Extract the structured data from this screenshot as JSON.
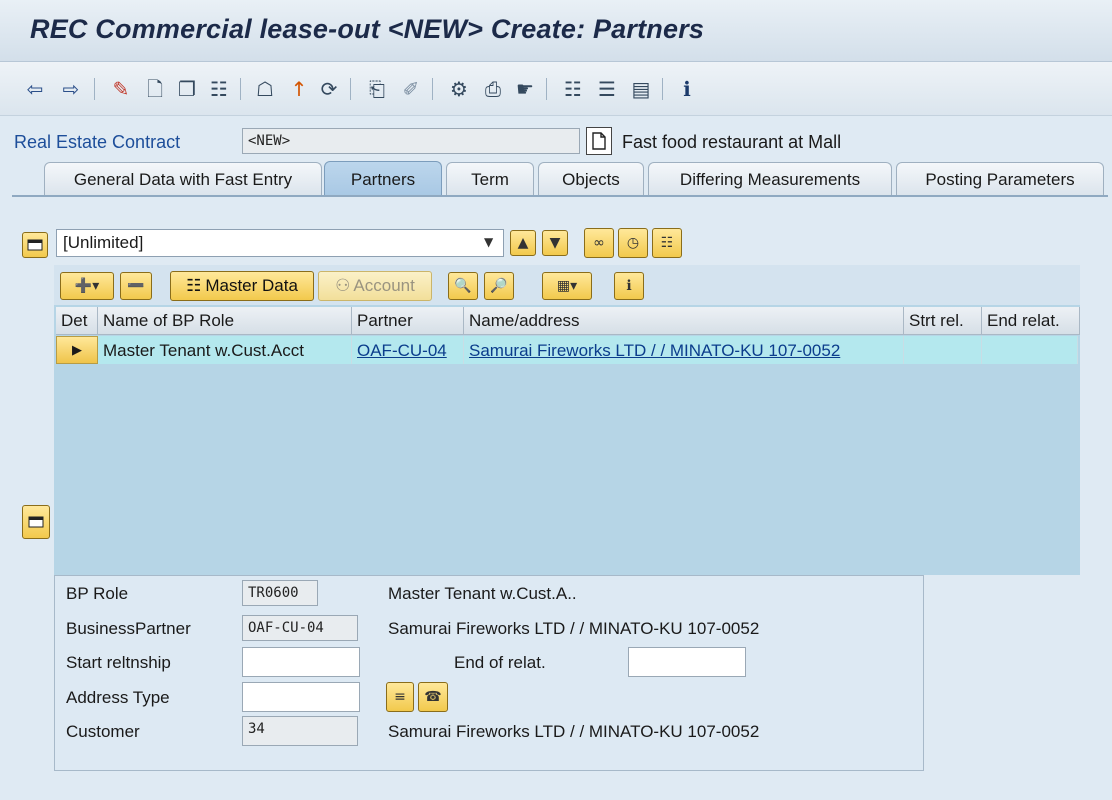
{
  "window": {
    "title": "REC Commercial lease-out <NEW> Create: Partners"
  },
  "toolbar": {
    "icons": [
      "back-arrow-icon",
      "forward-arrow-icon",
      "edit-pencil-icon",
      "new-document-icon",
      "copy-icon",
      "display-change-icon",
      "hierarchy-icon",
      "upload-icon",
      "refresh-icon",
      "export-icon",
      "eraser-icon",
      "settings-icon",
      "print-icon",
      "pointer-icon",
      "org-structure-icon",
      "stack-icon",
      "table-view-icon",
      "info-icon"
    ]
  },
  "contract": {
    "label": "Real Estate Contract",
    "number": "<NEW>",
    "description": "Fast food restaurant at Mall"
  },
  "tabs": [
    {
      "label": "General Data with Fast Entry"
    },
    {
      "label": "Partners",
      "active": true
    },
    {
      "label": "Term"
    },
    {
      "label": "Objects"
    },
    {
      "label": "Differing Measurements"
    },
    {
      "label": "Posting Parameters"
    }
  ],
  "filter": {
    "value": "[Unlimited]"
  },
  "grid_toolbar": {
    "master_data": "Master Data",
    "account": "Account"
  },
  "grid": {
    "columns": [
      "Det",
      "Name of BP Role",
      "Partner",
      "Name/address",
      "Strt rel.",
      "End relat."
    ],
    "rows": [
      {
        "role": "Master Tenant w.Cust.Acct",
        "partner": "OAF-CU-04",
        "name_address": "Samurai Fireworks LTD / / MINATO-KU 107-0052",
        "start": "",
        "end": ""
      }
    ]
  },
  "detail": {
    "bp_role_label": "BP Role",
    "bp_role_value": "TR0600",
    "bp_role_desc": "Master Tenant w.Cust.A..",
    "business_partner_label": "BusinessPartner",
    "business_partner_value": "OAF-CU-04",
    "business_partner_desc": "Samurai Fireworks LTD / / MINATO-KU 107-0052",
    "start_label": "Start reltnship",
    "start_value": "",
    "end_label": "End of relat.",
    "end_value": "",
    "address_type_label": "Address Type",
    "address_type_value": "",
    "customer_label": "Customer",
    "customer_value": "34",
    "customer_desc": "Samurai Fireworks LTD / / MINATO-KU 107-0052"
  },
  "colors": {
    "title_text": "#1c2a49",
    "link": "#0b3d8c",
    "selected_row": "#b4e8ee",
    "grid_bg": "#b6d5e6",
    "active_tab": "#a8c8e4",
    "button_yellow": "#f2c94c"
  }
}
